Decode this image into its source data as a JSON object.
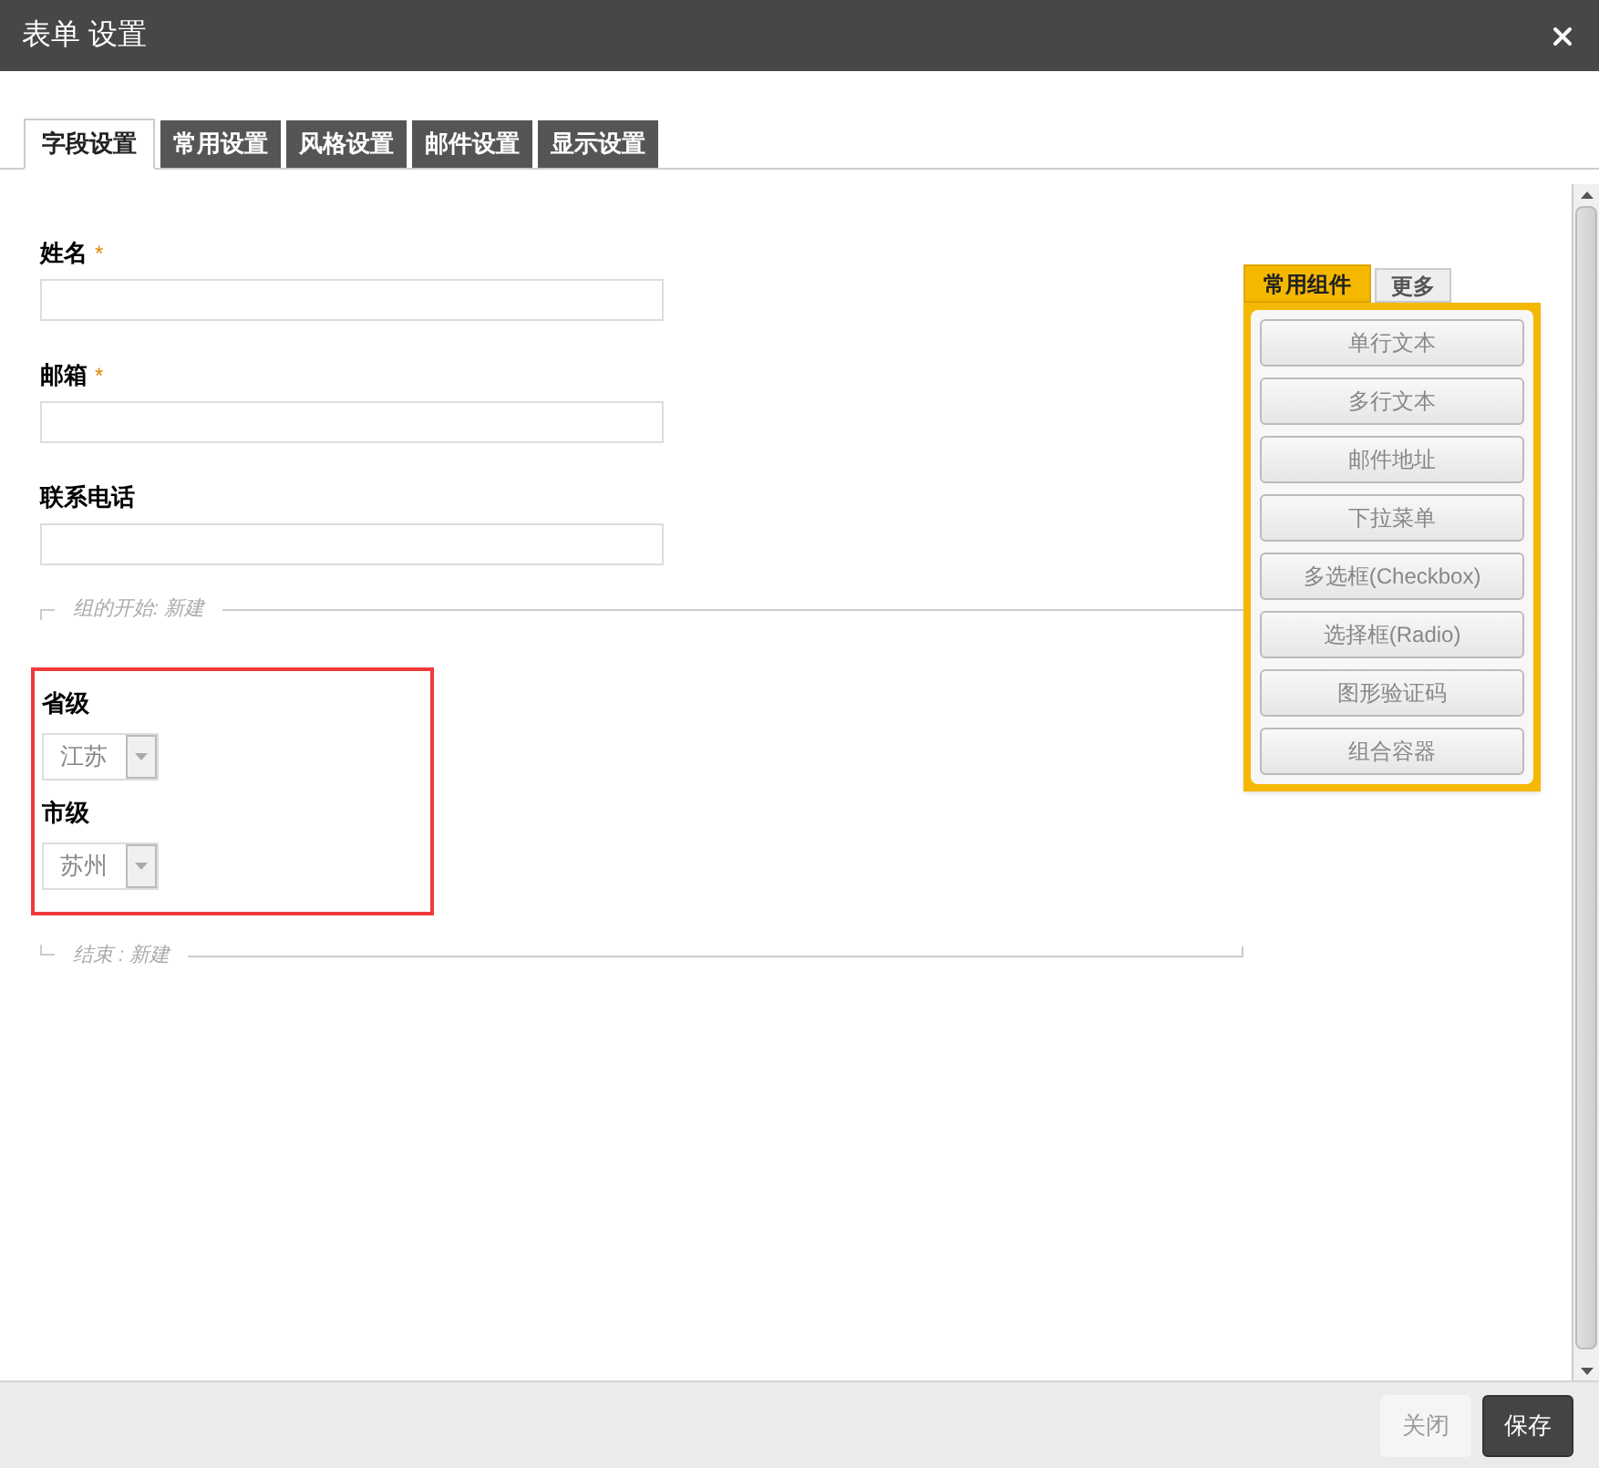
{
  "window": {
    "title": "表单 设置"
  },
  "tabs": [
    {
      "label": "字段设置",
      "selected": true
    },
    {
      "label": "常用设置",
      "selected": false
    },
    {
      "label": "风格设置",
      "selected": false
    },
    {
      "label": "邮件设置",
      "selected": false
    },
    {
      "label": "显示设置",
      "selected": false
    }
  ],
  "fields": [
    {
      "label": "姓名",
      "required_mark": "*"
    },
    {
      "label": "邮箱",
      "required_mark": "*"
    },
    {
      "label": "联系电话"
    }
  ],
  "group": {
    "start_label": "组的开始: 新建",
    "end_label": "结束 : 新建",
    "highlighted": true,
    "fields": [
      {
        "label": "省级",
        "value": "江苏"
      },
      {
        "label": "市级",
        "value": "苏州"
      }
    ]
  },
  "palette": {
    "tabs": [
      {
        "label": "常用组件",
        "selected": true
      },
      {
        "label": "更多",
        "selected": false
      }
    ],
    "items": [
      "单行文本",
      "多行文本",
      "邮件地址",
      "下拉菜单",
      "多选框(Checkbox)",
      "选择框(Radio)",
      "图形验证码",
      "组合容器"
    ]
  },
  "footer_buttons": [
    {
      "label": "关闭",
      "kind": "secondary"
    },
    {
      "label": "保存",
      "kind": "primary"
    }
  ]
}
